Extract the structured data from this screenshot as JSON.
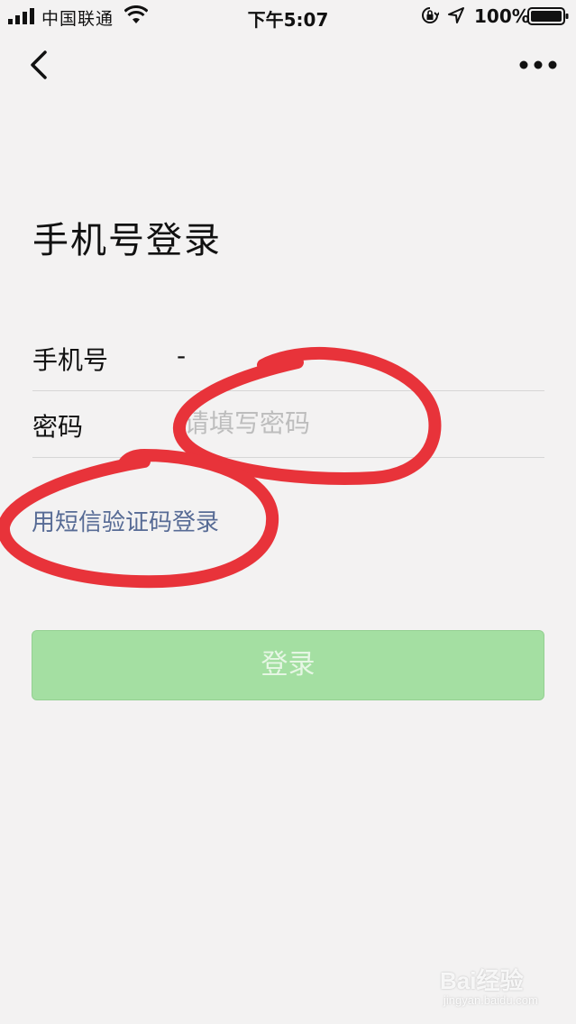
{
  "status_bar": {
    "carrier": "中国联通",
    "time": "下午5:07",
    "battery_percent": "100%",
    "icons": [
      "signal-icon",
      "wifi-icon",
      "orientation-lock-icon",
      "location-icon",
      "battery-icon"
    ]
  },
  "nav": {
    "back_icon": "chevron-left-icon",
    "more_icon": "more-dots-icon"
  },
  "title": "手机号登录",
  "form": {
    "phone": {
      "label": "手机号",
      "value": "-"
    },
    "password": {
      "label": "密码",
      "placeholder": "请填写密码",
      "value": ""
    }
  },
  "sms_link": "用短信验证码登录",
  "login_button": "登录",
  "watermark": {
    "text": "Bai经验",
    "sub": "jingyan.baidu.com"
  },
  "colors": {
    "background": "#f3f2f2",
    "link": "#576b95",
    "button_bg": "#a4dfa2",
    "button_text": "#e6f6e4",
    "annotation": "#e8333a"
  }
}
